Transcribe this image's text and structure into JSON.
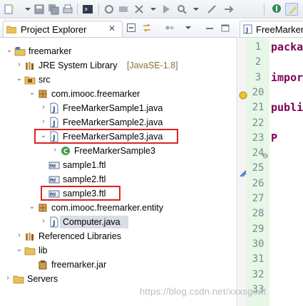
{
  "toolbar": {
    "icons": [
      "new-wizard-icon",
      "save-icon",
      "save-all-icon",
      "print-icon",
      "terminal-icon",
      "toggle-icon",
      "build-icon",
      "debug-icon",
      "run-icon",
      "search-icon",
      "perspective-icon"
    ]
  },
  "explorer": {
    "tab_label": "Project Explorer",
    "tab_close": "✕",
    "tree": [
      {
        "label": "freemarker",
        "icon": "project-icon",
        "twisty": "open"
      },
      {
        "label": "JRE System Library",
        "decoration": "[JavaSE-1.8]",
        "icon": "library-icon",
        "twisty": "closed"
      },
      {
        "label": "src",
        "icon": "source-folder-icon",
        "twisty": "open"
      },
      {
        "label": "com.imooc.freemarker",
        "icon": "package-icon",
        "twisty": "open"
      },
      {
        "label": "FreeMarkerSample1.java",
        "icon": "java-file-icon",
        "twisty": "closed"
      },
      {
        "label": "FreeMarkerSample2.java",
        "icon": "java-file-icon",
        "twisty": "closed"
      },
      {
        "label": "FreeMarkerSample3.java",
        "icon": "java-file-icon",
        "twisty": "open",
        "highlighted": true
      },
      {
        "label": "FreeMarkerSample3",
        "icon": "class-icon",
        "twisty": "closed"
      },
      {
        "label": "sample1.ftl",
        "icon": "ftl-file-icon",
        "twisty": "none"
      },
      {
        "label": "sample2.ftl",
        "icon": "ftl-file-icon",
        "twisty": "none"
      },
      {
        "label": "sample3.ftl",
        "icon": "ftl-file-icon",
        "twisty": "none",
        "highlighted": true
      },
      {
        "label": "com.imooc.freemarker.entity",
        "icon": "package-icon",
        "twisty": "open"
      },
      {
        "label": "Computer.java",
        "icon": "java-file-icon",
        "twisty": "closed",
        "selected": true
      },
      {
        "label": "Referenced Libraries",
        "icon": "library-icon",
        "twisty": "closed"
      },
      {
        "label": "lib",
        "icon": "folder-icon",
        "twisty": "open"
      },
      {
        "label": "freemarker.jar",
        "icon": "jar-icon",
        "twisty": "none"
      },
      {
        "label": "Servers",
        "icon": "folder-icon",
        "twisty": "closed"
      }
    ]
  },
  "editor": {
    "tab_label": "FreeMarker",
    "line_numbers": [
      "1",
      "2",
      "3",
      "20",
      "21",
      "22",
      "23",
      "24",
      "25",
      "26",
      "27",
      "28",
      "29",
      "30",
      "31",
      "32",
      "33"
    ],
    "code_lines": [
      "packa",
      "",
      "impor",
      "",
      "publi",
      "",
      "    P",
      "",
      "",
      "",
      "",
      "",
      "",
      "",
      "",
      "",
      ""
    ],
    "fold_marker": "⊖"
  },
  "watermark": "https://blog.csdn.net/xxxsgoat",
  "colors": {
    "highlight_box": "#e02020",
    "keyword": "#7f0055",
    "line_gutter": "#e6f7e6"
  }
}
